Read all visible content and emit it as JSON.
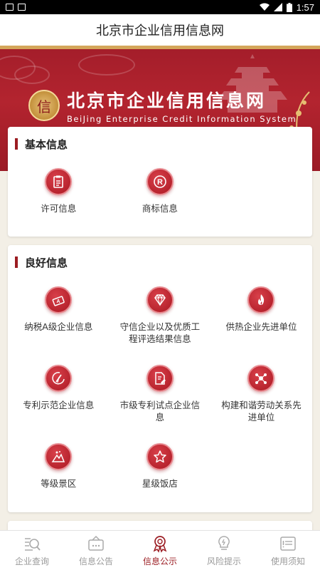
{
  "status_bar": {
    "time": "1:57"
  },
  "header": {
    "title": "北京市企业信用信息网"
  },
  "banner": {
    "seal_char": "信",
    "title_cn": "北京市企业信用信息网",
    "title_en": "BeiJing Enterprise Credit Information System"
  },
  "sections": {
    "basic": {
      "title": "基本信息",
      "items": [
        {
          "label": "许可信息",
          "icon": "clipboard-icon"
        },
        {
          "label": "商标信息",
          "icon": "trademark-icon"
        }
      ]
    },
    "good": {
      "title": "良好信息",
      "items": [
        {
          "label": "纳税A级企业信息",
          "icon": "tax-icon"
        },
        {
          "label": "守信企业以及优质工程评选结果信息",
          "icon": "diamond-icon"
        },
        {
          "label": "供热企业先进单位",
          "icon": "flame-icon"
        },
        {
          "label": "专利示范企业信息",
          "icon": "patent-icon"
        },
        {
          "label": "市级专利试点企业信息",
          "icon": "document-edit-icon"
        },
        {
          "label": "构建和谐劳动关系先进单位",
          "icon": "network-icon"
        },
        {
          "label": "等级景区",
          "icon": "mountain-icon"
        },
        {
          "label": "星级饭店",
          "icon": "star-icon"
        }
      ]
    }
  },
  "tabs": [
    {
      "label": "企业查询",
      "icon": "search-list-icon",
      "active": false
    },
    {
      "label": "信息公告",
      "icon": "announcement-icon",
      "active": false
    },
    {
      "label": "信息公示",
      "icon": "award-icon",
      "active": true
    },
    {
      "label": "风险提示",
      "icon": "lightbulb-icon",
      "active": false
    },
    {
      "label": "使用须知",
      "icon": "notice-icon",
      "active": false
    }
  ],
  "colors": {
    "brand": "#9b1c22",
    "banner": "#a31d2a",
    "gold": "#d4a65a",
    "background": "#f3efe6"
  }
}
